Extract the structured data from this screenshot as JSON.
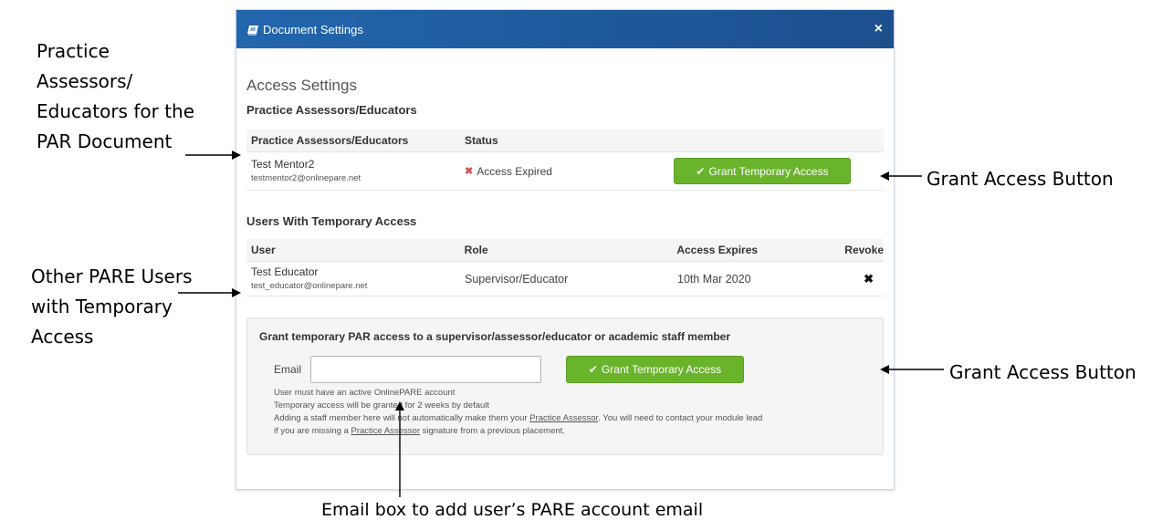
{
  "annotations": {
    "par_document": [
      "Practice",
      "Assessors/",
      "Educators for the",
      "PAR Document"
    ],
    "other_users": [
      "Other PARE Users",
      "with Temporary",
      "Access"
    ],
    "grant_button_1": "Grant Access Button",
    "grant_button_2": "Grant Access Button",
    "email_box": "Email box to add user’s PARE account email"
  },
  "modal": {
    "title": "Document Settings",
    "close_glyph": "×",
    "section_title": "Access Settings",
    "assessors": {
      "heading": "Practice Assessors/Educators",
      "columns": [
        "Practice Assessors/Educators",
        "Status"
      ],
      "rows": [
        {
          "name": "Test Mentor2",
          "email": "testmentor2@onlinepare.net",
          "status": "Access Expired",
          "action_label": "Grant Temporary Access"
        }
      ]
    },
    "temporary": {
      "heading": "Users With Temporary Access",
      "columns": [
        "User",
        "Role",
        "Access Expires",
        "Revoke"
      ],
      "rows": [
        {
          "name": "Test Educator",
          "email": "test_educator@onlinepare.net",
          "role": "Supervisor/Educator",
          "expires": "10th Mar 2020",
          "revoke_glyph": "✖"
        }
      ]
    },
    "grant_panel": {
      "heading": "Grant temporary PAR access to a supervisor/assessor/educator or academic staff member",
      "email_label": "Email",
      "email_value": "",
      "button_label": "Grant Temporary Access",
      "help_1": "User must have an active OnlinePARE account",
      "help_2": "Temporary access will be granted for 2 weeks by default",
      "help_3a": "Adding a staff member here will not automatically make them your ",
      "help_3_link": "Practice Assessor",
      "help_3b": ". You will need to contact your module lead",
      "help_4a": "if you are missing a ",
      "help_4_link": "Practice Assessor",
      "help_4b": " signature from a previous placement."
    }
  },
  "colors": {
    "header_blue": "#2266ad",
    "button_green": "#6ab42c",
    "status_red": "#d9534f"
  }
}
